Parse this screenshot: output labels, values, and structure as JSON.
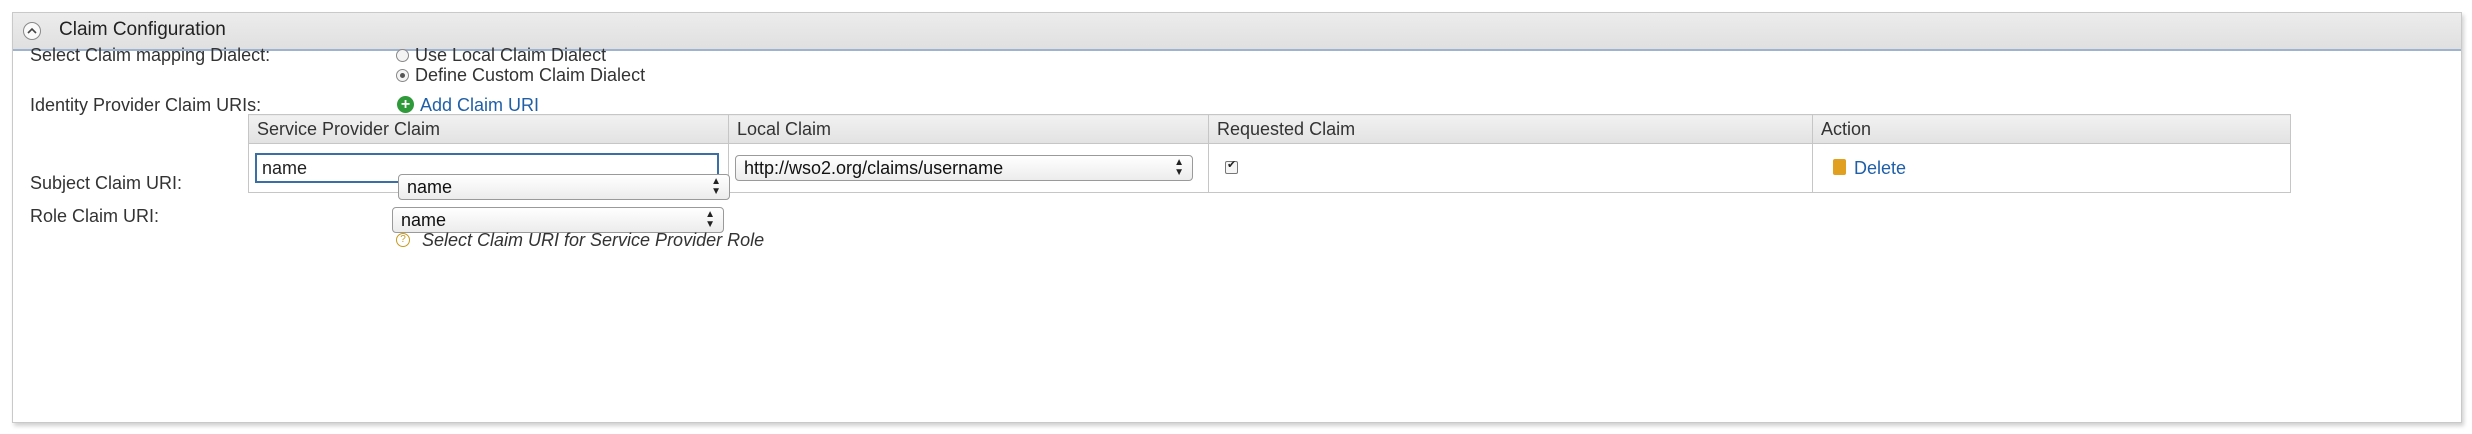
{
  "panel": {
    "title": "Claim Configuration"
  },
  "dialect": {
    "label": "Select Claim mapping Dialect:",
    "options": [
      {
        "label": "Use Local Claim Dialect",
        "checked": false
      },
      {
        "label": "Define Custom Claim Dialect",
        "checked": true
      }
    ]
  },
  "idp_claims": {
    "label": "Identity Provider Claim URIs:",
    "add_label": "Add Claim URI",
    "columns": [
      "Service Provider Claim",
      "Local Claim",
      "Requested Claim",
      "Action"
    ],
    "rows": [
      {
        "sp_claim": "name",
        "local_claim": "http://wso2.org/claims/username",
        "requested": true,
        "action_label": "Delete"
      }
    ]
  },
  "subject": {
    "label": "Subject Claim URI:",
    "selected": "name"
  },
  "role": {
    "label": "Role Claim URI:",
    "selected": "name",
    "hint": "Select Claim URI for Service Provider Role"
  },
  "icons": {
    "collapse": "chevron-up-icon",
    "add": "plus-circle-icon",
    "delete": "trash-icon",
    "help": "help-icon"
  }
}
